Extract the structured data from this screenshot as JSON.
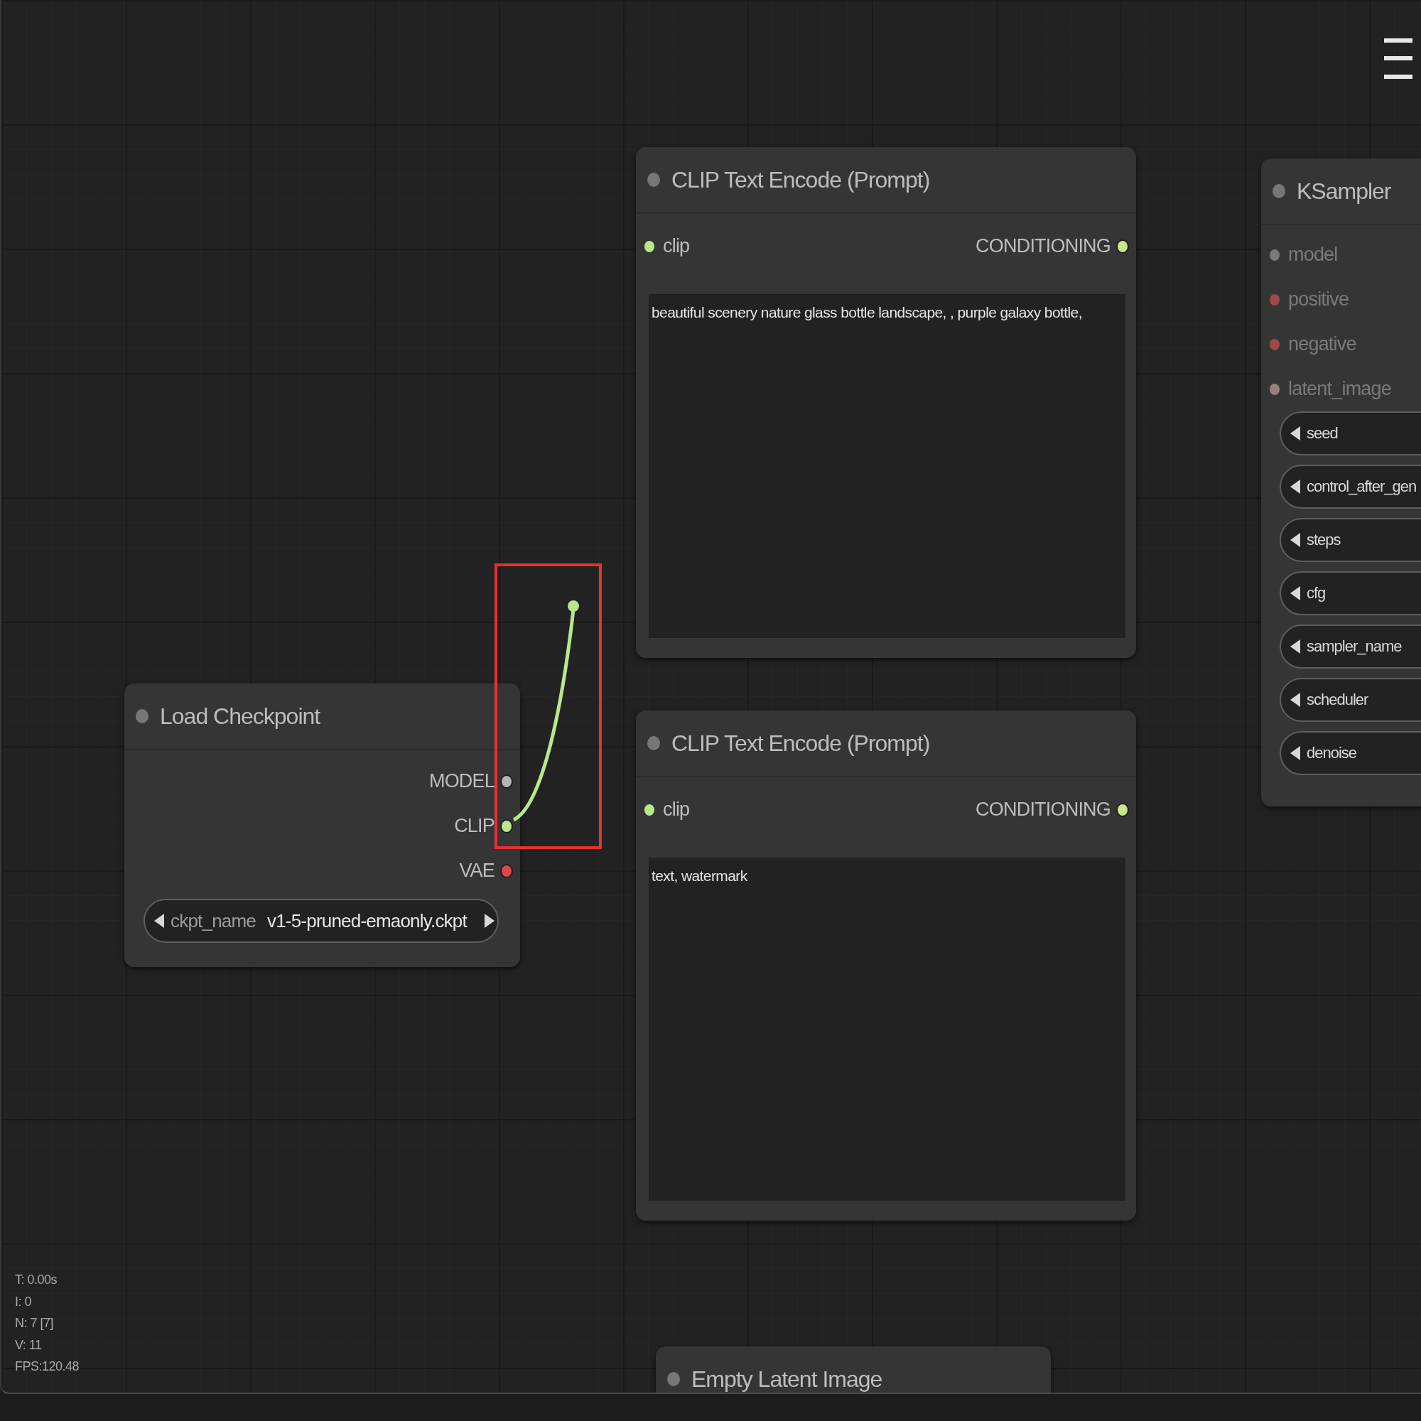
{
  "nodes": [
    {
      "kind": "text_encode",
      "title": "CLIP Text Encode (Prompt)",
      "inputs": [
        {
          "name": "clip",
          "color": "#b9e88b"
        }
      ],
      "outputs": [
        {
          "name": "CONDITIONING",
          "color": "#c8e88b"
        }
      ],
      "text": "beautiful scenery nature glass bottle landscape, , purple galaxy bottle,"
    },
    {
      "kind": "sampler",
      "title": "KSampler",
      "inputs": [
        {
          "name": "model",
          "color": "#7a7a7a"
        },
        {
          "name": "positive",
          "color": "#a34848"
        },
        {
          "name": "negative",
          "color": "#a34848"
        },
        {
          "name": "latent_image",
          "color": "#9a8080"
        }
      ],
      "widgets": [
        {
          "name": "seed"
        },
        {
          "name": "control_after_gen"
        },
        {
          "name": "steps"
        },
        {
          "name": "cfg"
        },
        {
          "name": "sampler_name"
        },
        {
          "name": "scheduler"
        },
        {
          "name": "denoise"
        }
      ]
    },
    {
      "kind": "loader",
      "title": "Load Checkpoint",
      "outputs": [
        {
          "name": "MODEL",
          "color": "#b5b5b5"
        },
        {
          "name": "CLIP",
          "color": "#b9e88b"
        },
        {
          "name": "VAE",
          "color": "#e0454c"
        }
      ],
      "widgets": [
        {
          "name": "ckpt_name",
          "value": "v1-5-pruned-emaonly.ckpt"
        }
      ]
    },
    {
      "kind": "text_encode",
      "title": "CLIP Text Encode (Prompt)",
      "inputs": [
        {
          "name": "clip",
          "color": "#b9e88b"
        }
      ],
      "outputs": [
        {
          "name": "CONDITIONING",
          "color": "#c8e88b"
        }
      ],
      "text": "text, watermark"
    },
    {
      "kind": "latent",
      "title": "Empty Latent Image"
    }
  ],
  "stats": [
    "T: 0.00s",
    "I: 0",
    "N: 7 [7]",
    "V: 11",
    "FPS:120.48"
  ]
}
